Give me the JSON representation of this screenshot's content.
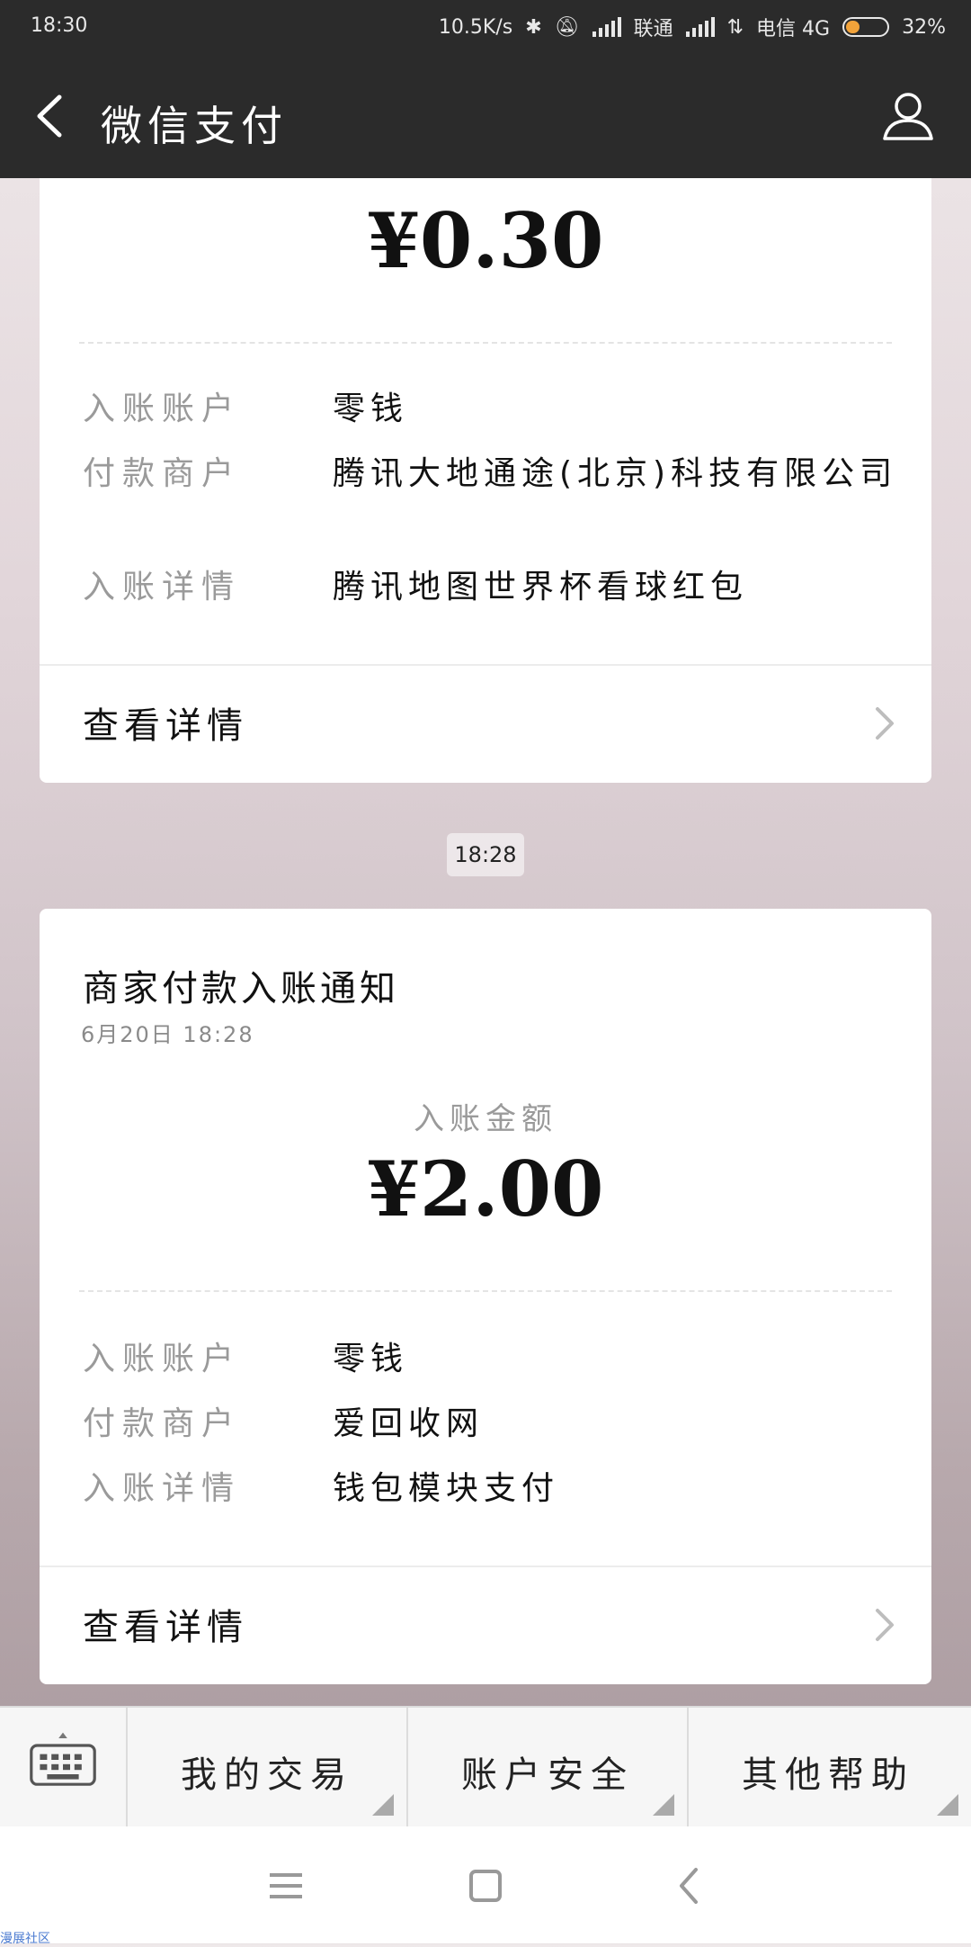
{
  "status_bar": {
    "time": "18:30",
    "net_speed": "10.5K/s",
    "carrier1": "联通",
    "carrier2": "电信 4G",
    "battery": "32%"
  },
  "header": {
    "title": "微信支付"
  },
  "cards": [
    {
      "amount": "¥0.30",
      "rows": [
        {
          "key": "入账账户",
          "value": "零钱"
        },
        {
          "key": "付款商户",
          "value": "腾讯大地通途(北京)科技有限公司"
        },
        {
          "key": "入账详情",
          "value": "腾讯地图世界杯看球红包"
        }
      ],
      "detail_label": "查看详情"
    },
    {
      "title": "商家付款入账通知",
      "date": "6月20日  18:28",
      "amount_label": "入账金额",
      "amount": "¥2.00",
      "rows": [
        {
          "key": "入账账户",
          "value": "零钱"
        },
        {
          "key": "付款商户",
          "value": "爱回收网"
        },
        {
          "key": "入账详情",
          "value": "钱包模块支付"
        }
      ],
      "detail_label": "查看详情"
    }
  ],
  "time_badge": "18:28",
  "menu": {
    "items": [
      "我的交易",
      "账户安全",
      "其他帮助"
    ]
  },
  "watermark": "漫展社区"
}
